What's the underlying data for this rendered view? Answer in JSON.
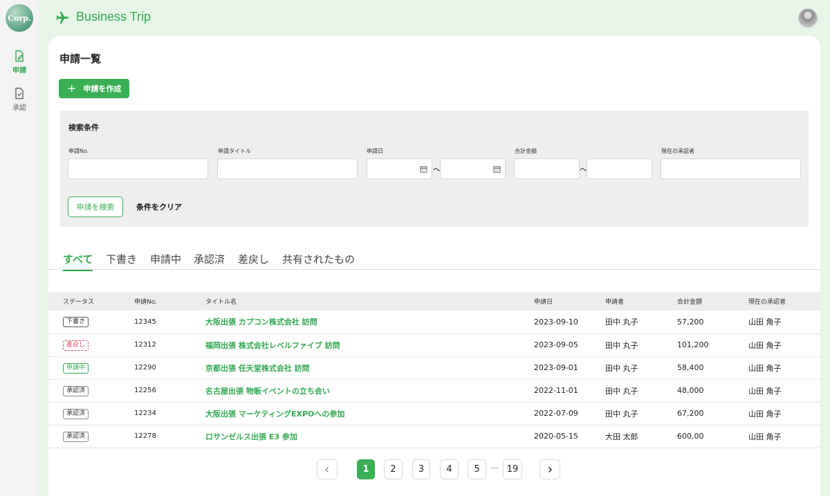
{
  "logo": "Corp.",
  "app": {
    "title": "Business Trip"
  },
  "sidebar": {
    "items": [
      {
        "label": "申請"
      },
      {
        "label": "承認"
      }
    ]
  },
  "page": {
    "title": "申請一覧"
  },
  "create_button": "申請を作成",
  "search": {
    "title": "検索条件",
    "fields": {
      "number": {
        "label": "申請No.",
        "value": "",
        "placeholder": ""
      },
      "title": {
        "label": "申請タイトル",
        "value": "",
        "placeholder": ""
      },
      "date": {
        "label": "申請日",
        "from": "",
        "to": ""
      },
      "amount": {
        "label": "合計金額",
        "from": "",
        "to": ""
      },
      "approver": {
        "label": "現在の承認者",
        "value": "",
        "placeholder": ""
      }
    },
    "range_separator": "〜",
    "search_button": "申請を検索",
    "clear_button": "条件をクリア"
  },
  "tabs": [
    {
      "label": "すべて",
      "active": true
    },
    {
      "label": "下書き"
    },
    {
      "label": "申請中"
    },
    {
      "label": "承認済"
    },
    {
      "label": "差戻し"
    },
    {
      "label": "共有されたもの"
    }
  ],
  "table": {
    "headers": [
      "ステータス",
      "申請No.",
      "タイトル名",
      "申請日",
      "申請者",
      "合計金額",
      "現在の承認者"
    ],
    "rows": [
      {
        "status": "下書き",
        "status_type": "draft",
        "number": "12345",
        "title": "大阪出張 カプコン株式会社 訪問",
        "date": "2023-09-10",
        "applicant": "田中 丸子",
        "amount": "57,200",
        "approver": "山田 角子"
      },
      {
        "status": "差戻し",
        "status_type": "returned",
        "number": "12312",
        "title": "福岡出張 株式会社レベルファイブ 訪問",
        "date": "2023-09-05",
        "applicant": "田中 丸子",
        "amount": "101,200",
        "approver": "山田 角子"
      },
      {
        "status": "申請中",
        "status_type": "pending",
        "number": "12290",
        "title": "京都出張 任天堂株式会社 訪問",
        "date": "2023-09-01",
        "applicant": "田中 丸子",
        "amount": "58,400",
        "approver": "山田 角子"
      },
      {
        "status": "承認済",
        "status_type": "approved",
        "number": "12256",
        "title": "名古屋出張 物販イベントの立ち会い",
        "date": "2022-11-01",
        "applicant": "田中 丸子",
        "amount": "48,000",
        "approver": "山田 角子"
      },
      {
        "status": "承認済",
        "status_type": "approved",
        "number": "12234",
        "title": "大阪出張 マーケティングEXPOへの参加",
        "date": "2022-07-09",
        "applicant": "田中 丸子",
        "amount": "67,200",
        "approver": "山田 角子"
      },
      {
        "status": "承認済",
        "status_type": "approved",
        "number": "12278",
        "title": "ロサンゼルス出張 E3 参加",
        "date": "2020-05-15",
        "applicant": "大田 太郎",
        "amount": "600,00",
        "approver": "山田 角子"
      }
    ]
  },
  "pagination": {
    "pages": [
      "1",
      "2",
      "3",
      "4",
      "5"
    ],
    "ellipsis": "···",
    "last": "19",
    "current": "1"
  },
  "colors": {
    "accent": "#34a853",
    "returned": "#e04a5f",
    "background": "#e6f5e8"
  },
  "icons": {
    "sidebar": [
      "document-edit-icon",
      "document-check-icon"
    ],
    "header": [
      "airplane-icon"
    ],
    "date": "calendar-icon"
  }
}
